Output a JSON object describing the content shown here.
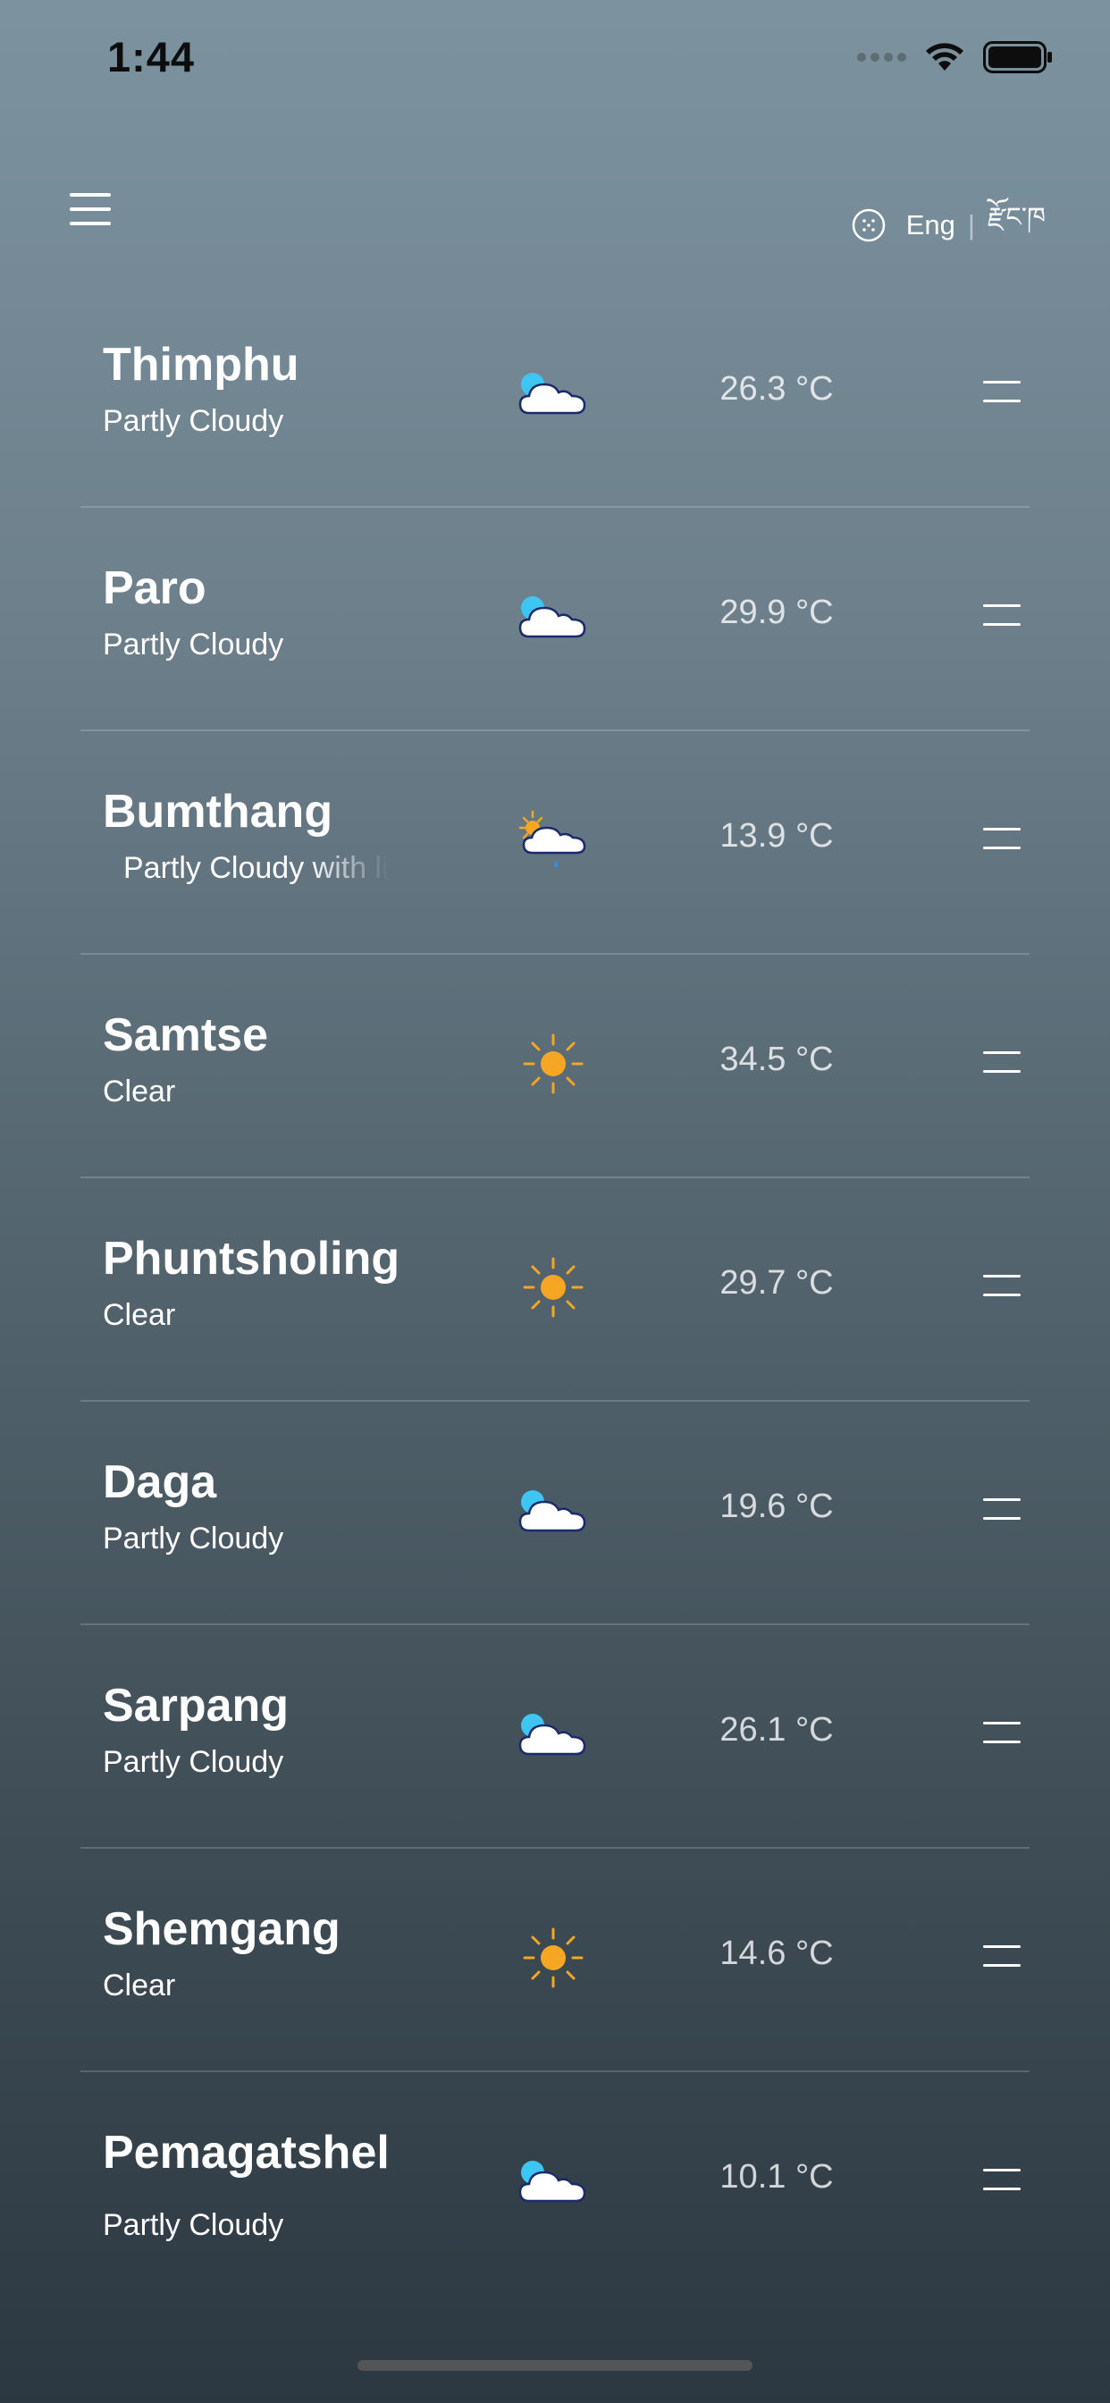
{
  "status_bar": {
    "time": "1:44"
  },
  "header": {
    "menu_icon": "hamburger-icon",
    "language": {
      "globe_icon": "globe-icon",
      "english_label": "Eng",
      "separator": "|",
      "dzongkha_label": "རྫོང་ཁ"
    }
  },
  "colors": {
    "sun": "#f5a623",
    "cloud_sun": "#3ec6f2",
    "cloud_outline": "#1a2a6c",
    "rain_drop": "#2f8fe0"
  },
  "cities": [
    {
      "name": "Thimphu",
      "condition": "Partly Cloudy",
      "icon": "partly-cloudy-icon",
      "temperature": "26.3 °C"
    },
    {
      "name": "Paro",
      "condition": "Partly Cloudy",
      "icon": "partly-cloudy-icon",
      "temperature": "29.9 °C"
    },
    {
      "name": "Bumthang",
      "condition": "Partly Cloudy with li",
      "icon": "partly-cloudy-rain-icon",
      "temperature": "13.9 °C"
    },
    {
      "name": "Samtse",
      "condition": "Clear",
      "icon": "sun-icon",
      "temperature": "34.5 °C"
    },
    {
      "name": "Phuntsholing",
      "condition": "Clear",
      "icon": "sun-icon",
      "temperature": "29.7 °C"
    },
    {
      "name": "Daga",
      "condition": "Partly Cloudy",
      "icon": "partly-cloudy-icon",
      "temperature": "19.6 °C"
    },
    {
      "name": "Sarpang",
      "condition": "Partly Cloudy",
      "icon": "partly-cloudy-icon",
      "temperature": "26.1 °C"
    },
    {
      "name": "Shemgang",
      "condition": "Clear",
      "icon": "sun-icon",
      "temperature": "14.6 °C"
    },
    {
      "name": "Pemagatshel",
      "condition": "Partly Cloudy",
      "icon": "partly-cloudy-icon",
      "temperature": "10.1 °C"
    }
  ]
}
